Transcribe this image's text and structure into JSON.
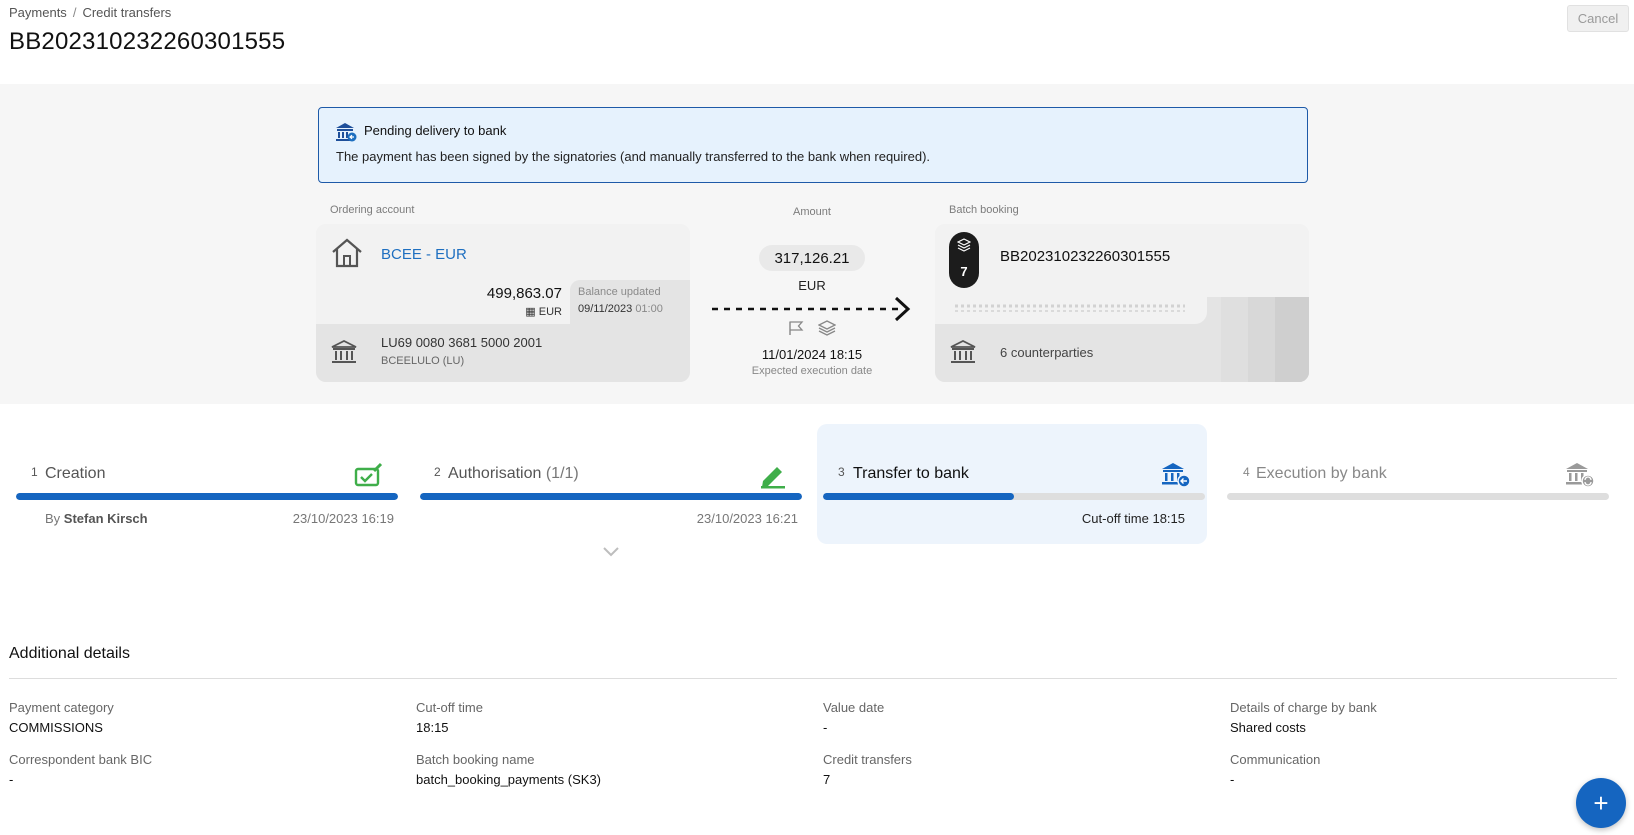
{
  "breadcrumb": {
    "root": "Payments",
    "separator": "/",
    "current": "Credit transfers"
  },
  "page_title": "BB202310232260301555",
  "cancel_label": "Cancel",
  "status_banner": {
    "title": "Pending delivery to bank",
    "description": "The payment has been signed by the signatories (and manually transferred to the bank when required).",
    "border_color": "#1e5aa8",
    "background_color": "#e6f2fd"
  },
  "ordering_account": {
    "label": "Ordering account",
    "name": "BCEE - EUR",
    "balance": "499,863.07",
    "balance_currency": "EUR",
    "balance_updated_label": "Balance updated",
    "balance_updated_date": "09/11/2023",
    "balance_updated_time": "01:00",
    "iban": "LU69 0080 3681 5000 2001",
    "bic": "BCEELULO (LU)"
  },
  "amount": {
    "label": "Amount",
    "value": "317,126.21",
    "currency": "EUR",
    "execution_datetime": "11/01/2024 18:15",
    "execution_label": "Expected execution date"
  },
  "batch_booking": {
    "label": "Batch booking",
    "count": "7",
    "reference": "BB202310232260301555",
    "counterparties": "6 counterparties"
  },
  "steps": [
    {
      "number": "1",
      "name": "Creation",
      "sub": "",
      "by_prefix": "By",
      "by_user": "Stefan Kirsch",
      "date": "23/10/2023 16:19",
      "progress": 1.0,
      "state": "done",
      "icon": "edit-check-icon"
    },
    {
      "number": "2",
      "name": "Authorisation",
      "sub": "(1/1)",
      "date": "23/10/2023 16:21",
      "progress": 1.0,
      "state": "done",
      "icon": "pen-icon"
    },
    {
      "number": "3",
      "name": "Transfer to bank",
      "sub": "",
      "cutoff": "Cut-off time 18:15",
      "progress": 0.5,
      "state": "active",
      "icon": "bank-transfer-icon"
    },
    {
      "number": "4",
      "name": "Execution by bank",
      "sub": "",
      "progress": 0.0,
      "state": "pending",
      "icon": "bank-sync-icon"
    }
  ],
  "additional_details": {
    "title": "Additional details",
    "fields": [
      {
        "label": "Payment category",
        "value": "COMMISSIONS"
      },
      {
        "label": "Cut-off time",
        "value": "18:15"
      },
      {
        "label": "Value date",
        "value": "-"
      },
      {
        "label": "Details of charge by bank",
        "value": "Shared costs"
      },
      {
        "label": "Correspondent bank BIC",
        "value": "-"
      },
      {
        "label": "Batch booking name",
        "value": "batch_booking_payments (SK3)"
      },
      {
        "label": "Credit transfers",
        "value": "7"
      },
      {
        "label": "Communication",
        "value": "-"
      }
    ]
  },
  "fab_label": "+",
  "colors": {
    "accent": "#1565c0",
    "link": "#1e6fc0",
    "success": "#3fae4a",
    "band": "#f6f6f6"
  }
}
